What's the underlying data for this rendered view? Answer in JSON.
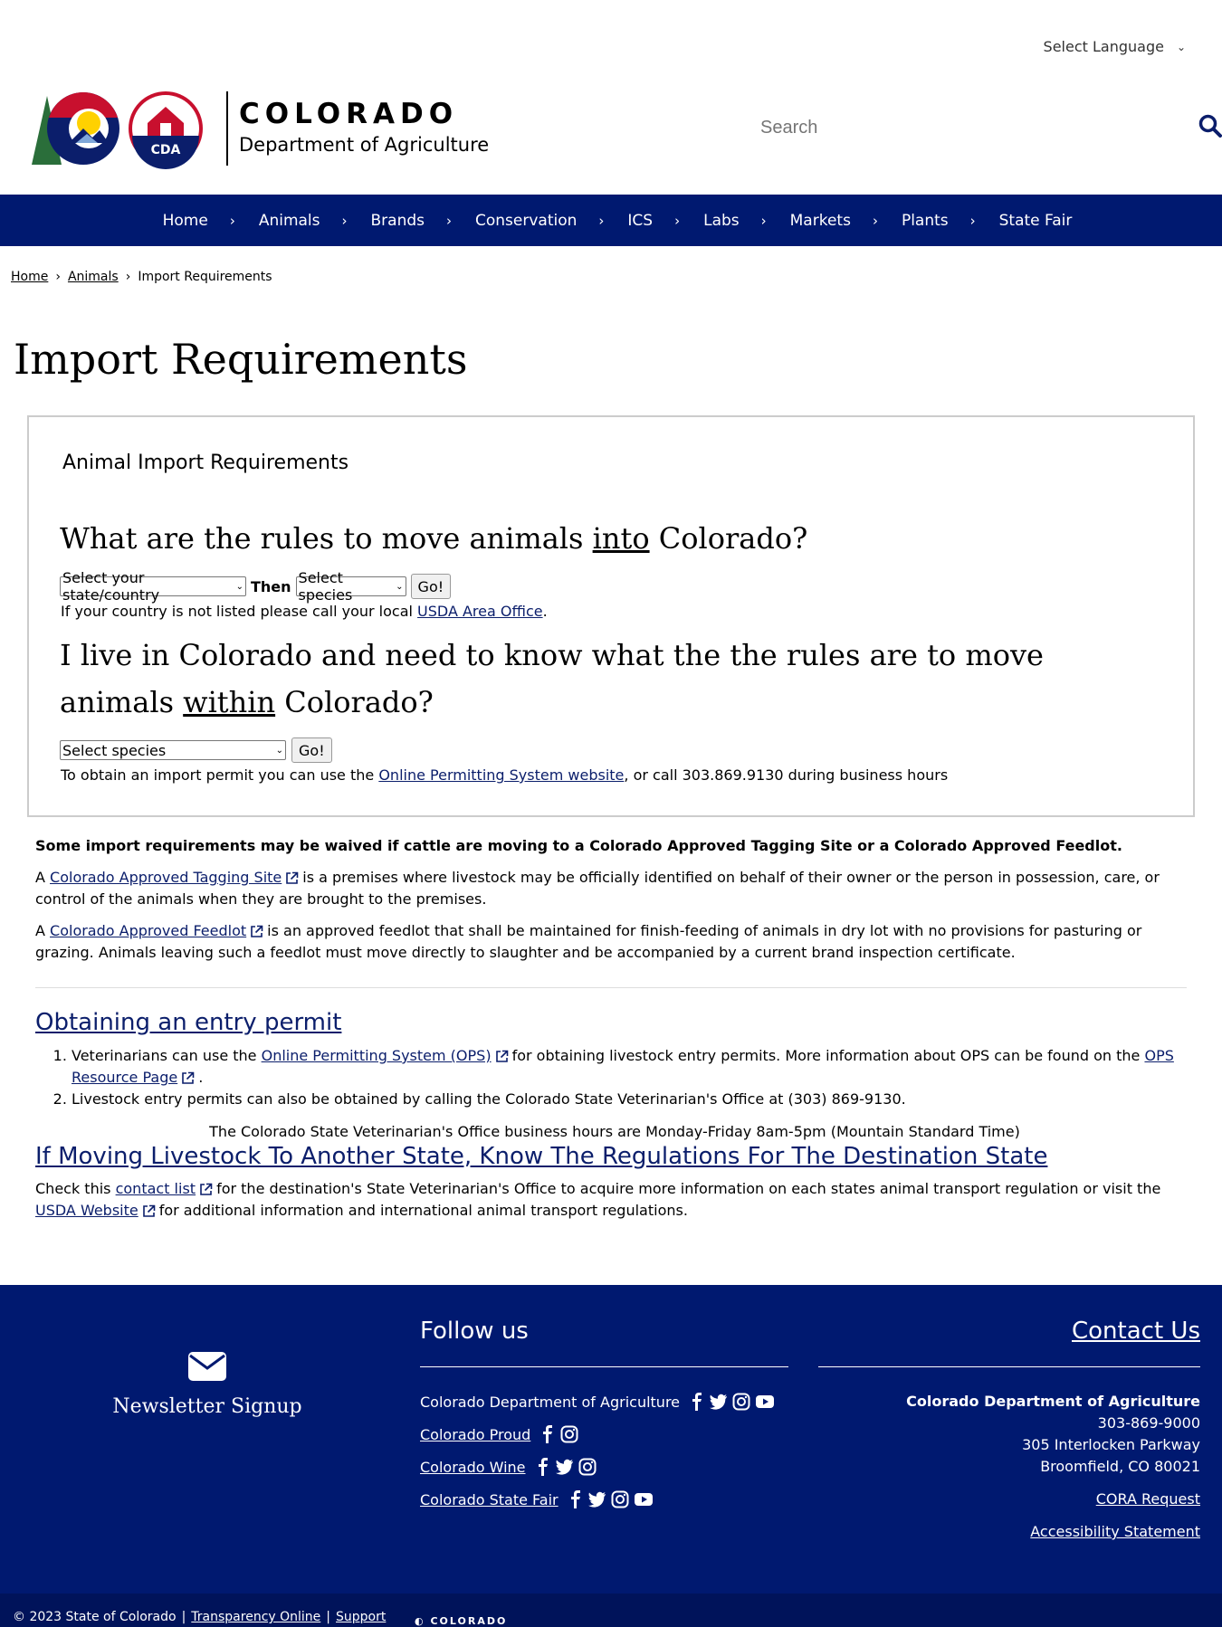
{
  "language": {
    "label": "Select Language"
  },
  "header": {
    "logo_word": "COLORADO",
    "logo_dept": "Department of Agriculture",
    "logo_cda": "CDA",
    "search_placeholder": "Search"
  },
  "nav": {
    "items": [
      {
        "label": "Home"
      },
      {
        "label": "Animals"
      },
      {
        "label": "Brands"
      },
      {
        "label": "Conservation"
      },
      {
        "label": "ICS"
      },
      {
        "label": "Labs"
      },
      {
        "label": "Markets"
      },
      {
        "label": "Plants"
      },
      {
        "label": "State Fair"
      }
    ]
  },
  "breadcrumb": {
    "home": "Home",
    "animals": "Animals",
    "current": "Import Requirements"
  },
  "page_title": "Import Requirements",
  "box": {
    "title": "Animal Import Requirements",
    "q1_pre": "What are the rules to move animals ",
    "q1_em": "into",
    "q1_post": " Colorado?",
    "state_select": "Select your state/country",
    "then": "Then",
    "species_select": "Select species",
    "go": "Go!",
    "note1_pre": "If your country is not listed please call your local ",
    "note1_link": "USDA Area Office",
    "note1_post": ".",
    "q2_pre": "I live in Colorado and need to know what the the rules are to move animals ",
    "q2_em": "within",
    "q2_post": " Colorado?",
    "species_select2": "Select species",
    "go2": "Go!",
    "note2_pre": "To obtain an import permit you can use the ",
    "note2_link": "Online Permitting System website",
    "note2_post": ", or call 303.869.9130 during business hours"
  },
  "waiver": {
    "bold": "Some import requirements may be waived if cattle are moving to a Colorado Approved Tagging Site or a Colorado Approved Feedlot.",
    "p1_a": "A ",
    "p1_link": "Colorado Approved Tagging Site",
    "p1_rest": "is a premises where livestock may be officially identified on behalf of their owner or the person in possession, care, or control of the animals when they are brought to the premises.",
    "p2_a": "A ",
    "p2_link": "Colorado Approved Feedlot",
    "p2_rest": "is an approved feedlot that shall be maintained for finish-feeding of animals in dry lot with no provisions for pasturing or grazing. Animals leaving such a feedlot must move directly to slaughter and be accompanied by a current brand inspection certificate."
  },
  "entry": {
    "heading": "Obtaining an entry permit",
    "li1_pre": "Veterinarians can use the ",
    "li1_link": "Online Permitting System (OPS)",
    "li1_mid": "for obtaining livestock entry permits. More information about OPS can be found on the ",
    "li1_link2": "OPS Resource Page",
    "li1_post": ".",
    "li2": "Livestock entry permits can also be obtained by calling the Colorado State Veterinarian's Office at (303) 869-9130.",
    "hours": "The Colorado State Veterinarian's Office business hours are Monday-Friday 8am-5pm (Mountain Standard Time)"
  },
  "moving": {
    "heading": "If Moving Livestock To Another State, Know The Regulations For The Destination State",
    "pre": "Check this ",
    "link1": "contact list",
    "mid": "for the destination's State Veterinarian's Office to acquire more information on each states animal transport regulation or visit the ",
    "link2": "USDA Website",
    "post": "for additional information and international animal transport regulations."
  },
  "footer": {
    "newsletter": "Newsletter Signup",
    "follow_title": "Follow us",
    "follow": [
      {
        "label": "Colorado Department of Agriculture"
      },
      {
        "label": "Colorado Proud"
      },
      {
        "label": "Colorado Wine"
      },
      {
        "label": "Colorado State Fair"
      }
    ],
    "contact_title": "Contact Us",
    "org": "Colorado Department of Agriculture",
    "phone": "303-869-9000",
    "address1": "305 Interlocken Parkway",
    "address2": "Broomfield, CO 80021",
    "cora": "CORA Request",
    "accessibility": "Accessibility Statement"
  },
  "bottom": {
    "copyright": "© 2023 State of Colorado",
    "sep": "|",
    "transparency": "Transparency Online",
    "support": "Support",
    "colorado": "COLORADO"
  },
  "colors": {
    "navy": "#001970",
    "link": "#0b1e6b",
    "logo_red": "#c8102e",
    "logo_gold": "#ffd100",
    "logo_green": "#2a6e3a"
  }
}
